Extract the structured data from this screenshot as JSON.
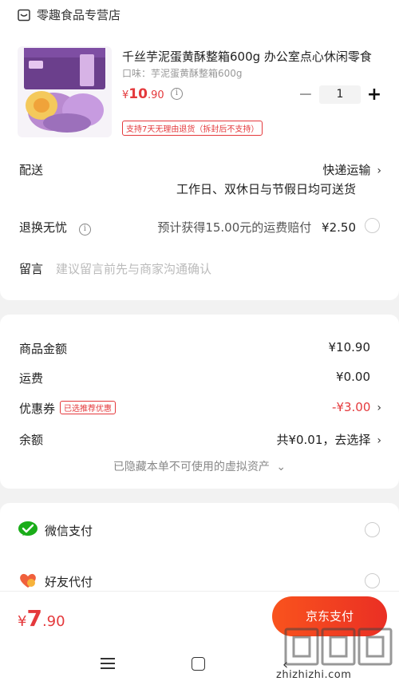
{
  "shop": {
    "name": "零趣食品专营店",
    "icon": "store-icon"
  },
  "product": {
    "title": "千丝芋泥蛋黄酥整箱600g 办公室点心休闲零食",
    "spec": "口味：芋泥蛋黄酥整箱600g",
    "price_symbol": "¥",
    "price_int": "10",
    "price_dec": ".90",
    "info_icon": "i",
    "quantity": "1",
    "minus": "−",
    "plus": "+",
    "return_tag": "支持7天无理由退货（拆封后不支持）"
  },
  "delivery": {
    "label": "配送",
    "method": "快递运输",
    "detail": "工作日、双休日与节假日均可送货"
  },
  "return_worry": {
    "label": "退换无忧",
    "info_icon": "i",
    "desc": "预计获得15.00元的运费赔付",
    "price": "¥2.50"
  },
  "remark": {
    "label": "留言",
    "placeholder": "建议留言前先与商家沟通确认"
  },
  "summary": {
    "goods_label": "商品金额",
    "goods_value": "¥10.90",
    "shipping_label": "运费",
    "shipping_value": "¥0.00",
    "coupon_label": "优惠券",
    "coupon_tag": "已选推荐优惠",
    "coupon_value": "-¥3.00",
    "balance_label": "余额",
    "balance_value": "共¥0.01，去选择",
    "hidden_assets": "已隐藏本单不可使用的虚拟资产",
    "hidden_chevron": "⌄"
  },
  "payment": {
    "wechat": "微信支付",
    "friend": "好友代付"
  },
  "bottom": {
    "total_symbol": "¥",
    "total_int": "7",
    "total_dec": ".90",
    "pay_button": "京东支付"
  },
  "chevron": "›",
  "nav": {
    "back": "‹"
  },
  "watermark": {
    "domain": "zhizhizhi.com"
  },
  "colors": {
    "accent": "#e4393c",
    "wechat": "#1aad19",
    "button_start": "#f9531d",
    "button_end": "#ea2f24"
  }
}
